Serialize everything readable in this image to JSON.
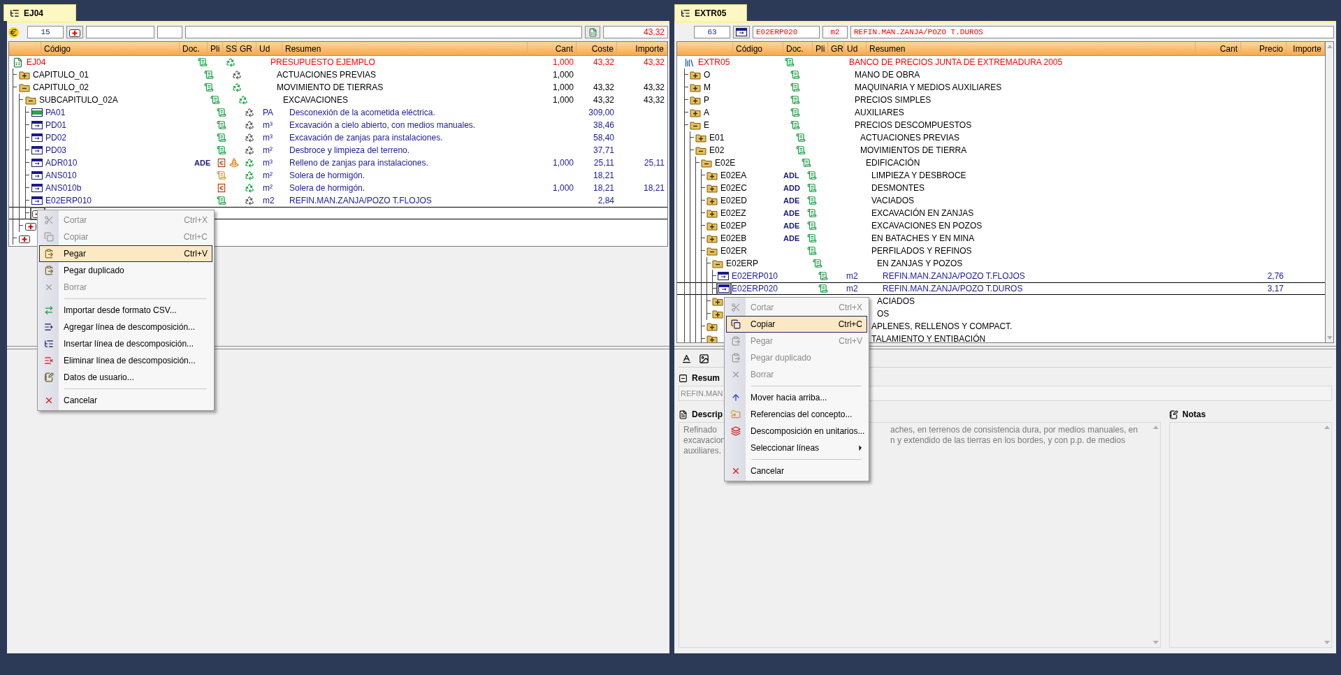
{
  "left_panel": {
    "tab": "EJ04",
    "toolbar": {
      "count": "15",
      "total": "43,32"
    },
    "columns": [
      "Código",
      "Doc.",
      "Pli",
      "SS",
      "GR",
      "Ud",
      "Resumen",
      "Cant",
      "Coste",
      "Importe"
    ],
    "rows": [
      {
        "kind": "root",
        "code": "EJ04",
        "pli": {
          "kind": "green"
        },
        "gr": {
          "kind": "green"
        },
        "summary": "PRESUPUESTO EJEMPLO",
        "cant": "1,000",
        "price": "43,32",
        "amount": "43,32",
        "selected": false,
        "children": [
          {
            "kind": "chapter",
            "code": "CAPITULO_01",
            "pli": {
              "kind": "green"
            },
            "gr": {
              "kind": "gray"
            },
            "summary": "ACTUACIONES PREVIAS",
            "cant": "1,000",
            "selected": false,
            "expanded": false
          },
          {
            "kind": "chapter",
            "code": "CAPITULO_02",
            "pli": {
              "kind": "green"
            },
            "gr": {
              "kind": "green"
            },
            "summary": "MOVIMIENTO DE TIERRAS",
            "cant": "1,000",
            "price": "43,32",
            "amount": "43,32",
            "selected": false,
            "expanded": true,
            "children": [
              {
                "kind": "chapter",
                "code": "SUBCAPITULO_02A",
                "pli": {
                  "kind": "green"
                },
                "gr": {
                  "kind": "green"
                },
                "summary": "EXCAVACIONES",
                "cant": "1,000",
                "price": "43,32",
                "amount": "43,32",
                "selected": false,
                "expanded": true,
                "children": [
                  {
                    "kind": "lump",
                    "code": "PA01",
                    "pli": {
                      "kind": "green"
                    },
                    "gr": {
                      "kind": "gray"
                    },
                    "unit": "PA",
                    "summary": "Desconexión de la acometida eléctrica.",
                    "price": "309,00",
                    "selected": false
                  },
                  {
                    "kind": "item",
                    "code": "PD01",
                    "pli": {
                      "kind": "green"
                    },
                    "gr": {
                      "kind": "gray"
                    },
                    "unit": "m³",
                    "summary": "Excavación a cielo abierto, con medios manuales.",
                    "price": "38,46",
                    "selected": false
                  },
                  {
                    "kind": "item",
                    "code": "PD02",
                    "pli": {
                      "kind": "green"
                    },
                    "gr": {
                      "kind": "gray"
                    },
                    "unit": "m³",
                    "summary": "Excavación de zanjas para instalaciones.",
                    "price": "58,40",
                    "selected": false
                  },
                  {
                    "kind": "item",
                    "code": "PD03",
                    "pli": {
                      "kind": "green"
                    },
                    "gr": {
                      "kind": "gray"
                    },
                    "unit": "m²",
                    "summary": "Desbroce y limpieza del terreno.",
                    "price": "37,71",
                    "selected": false
                  },
                  {
                    "kind": "item",
                    "code": "ADR010",
                    "doc": "ADE",
                    "pli": {
                      "kind": "euro"
                    },
                    "ss": {
                      "kind": "cone"
                    },
                    "gr": {
                      "kind": "green"
                    },
                    "unit": "m³",
                    "summary": "Relleno de zanjas para instalaciones.",
                    "cant": "1,000",
                    "price": "25,11",
                    "amount": "25,11",
                    "selected": false
                  },
                  {
                    "kind": "item",
                    "code": "ANS010",
                    "pli": {
                      "kind": "yellow"
                    },
                    "gr": {
                      "kind": "green"
                    },
                    "unit": "m²",
                    "summary": "Solera de hormigón.",
                    "price": "18,21",
                    "selected": false
                  },
                  {
                    "kind": "item",
                    "code": "ANS010b",
                    "pli": {
                      "kind": "euro"
                    },
                    "gr": {
                      "kind": "green"
                    },
                    "unit": "m²",
                    "summary": "Solera de hormigón.",
                    "cant": "1,000",
                    "price": "18,21",
                    "amount": "18,21",
                    "selected": false
                  },
                  {
                    "kind": "item",
                    "code": "E02ERP010",
                    "pli": {
                      "kind": "green"
                    },
                    "gr": {
                      "kind": "gray"
                    },
                    "unit": "m2",
                    "summary": "REFIN.MAN.ZANJA/POZO T.FLOJOS",
                    "price": "2,84",
                    "selected": false
                  },
                  {
                    "kind": "new",
                    "selected": true
                  }
                ]
              },
              {
                "kind": "new",
                "selected": false
              }
            ]
          },
          {
            "kind": "new",
            "selected": false
          }
        ]
      }
    ],
    "context_menu": [
      {
        "kind": "item",
        "label": "Cortar",
        "shortcut": "Ctrl+X",
        "disabled": true,
        "selected": false,
        "submenu": false
      },
      {
        "kind": "item",
        "label": "Copiar",
        "shortcut": "Ctrl+C",
        "disabled": true,
        "selected": false,
        "submenu": false
      },
      {
        "kind": "item",
        "label": "Pegar",
        "shortcut": "Ctrl+V",
        "disabled": false,
        "selected": true,
        "submenu": false
      },
      {
        "kind": "item",
        "label": "Pegar duplicado",
        "disabled": false,
        "selected": false,
        "submenu": false
      },
      {
        "kind": "item",
        "label": "Borrar",
        "disabled": true,
        "selected": false,
        "submenu": false
      },
      {
        "kind": "separator"
      },
      {
        "kind": "item",
        "label": "Importar desde formato CSV...",
        "disabled": false,
        "selected": false,
        "submenu": false
      },
      {
        "kind": "item",
        "label": "Agregar línea de descomposición...",
        "disabled": false,
        "selected": false,
        "submenu": false
      },
      {
        "kind": "item",
        "label": "Insertar línea de descomposición...",
        "disabled": false,
        "selected": false,
        "submenu": false
      },
      {
        "kind": "item",
        "label": "Eliminar línea de descomposición...",
        "disabled": false,
        "selected": false,
        "submenu": false
      },
      {
        "kind": "item",
        "label": "Datos de usuario...",
        "disabled": false,
        "selected": false,
        "submenu": false
      },
      {
        "kind": "separator"
      },
      {
        "kind": "item",
        "label": "Cancelar",
        "disabled": false,
        "selected": false,
        "submenu": false
      }
    ]
  },
  "right_panel": {
    "tab": "EXTR05",
    "toolbar": {
      "count": "63",
      "code": "E02ERP020",
      "unit": "m2",
      "summary": "REFIN.MAN.ZANJA/POZO T.DUROS"
    },
    "columns": [
      "Código",
      "Doc.",
      "Pli",
      "GR",
      "Ud",
      "Resumen",
      "Cant",
      "Precio",
      "Importe"
    ],
    "rows": [
      {
        "kind": "root",
        "code": "EXTR05",
        "pli": {
          "kind": "green"
        },
        "summary": "BANCO DE PRECIOS JUNTA DE EXTREMADURA 2005",
        "selected": false,
        "children": [
          {
            "kind": "chapter",
            "code": "O",
            "pli": {
              "kind": "green"
            },
            "summary": "MANO DE OBRA",
            "selected": false,
            "expanded": false
          },
          {
            "kind": "chapter",
            "code": "M",
            "pli": {
              "kind": "green"
            },
            "summary": "MAQUINARIA Y MEDIOS AUXILIARES",
            "selected": false,
            "expanded": false
          },
          {
            "kind": "chapter",
            "code": "P",
            "pli": {
              "kind": "green"
            },
            "summary": "PRECIOS SIMPLES",
            "selected": false,
            "expanded": false
          },
          {
            "kind": "chapter",
            "code": "A",
            "pli": {
              "kind": "green"
            },
            "summary": "AUXILIARES",
            "selected": false,
            "expanded": false
          },
          {
            "kind": "chapter",
            "code": "E",
            "pli": {
              "kind": "green"
            },
            "summary": "PRECIOS DESCOMPUESTOS",
            "selected": false,
            "expanded": true,
            "children": [
              {
                "kind": "chapter",
                "code": "E01",
                "pli": {
                  "kind": "green"
                },
                "summary": "ACTUACIONES PREVIAS",
                "selected": false,
                "expanded": false
              },
              {
                "kind": "chapter",
                "code": "E02",
                "pli": {
                  "kind": "green"
                },
                "summary": "MOVIMIENTOS DE TIERRA",
                "selected": false,
                "expanded": true,
                "children": [
                  {
                    "kind": "chapter",
                    "code": "E02E",
                    "pli": {
                      "kind": "green"
                    },
                    "summary": "EDIFICACIÓN",
                    "selected": false,
                    "expanded": true,
                    "children": [
                      {
                        "kind": "chapter",
                        "code": "E02EA",
                        "doc": "ADL",
                        "pli": {
                          "kind": "green"
                        },
                        "summary": "LIMPIEZA Y DESBROCE",
                        "selected": false,
                        "expanded": false
                      },
                      {
                        "kind": "chapter",
                        "code": "E02EC",
                        "doc": "ADD",
                        "pli": {
                          "kind": "green"
                        },
                        "summary": "DESMONTES",
                        "selected": false,
                        "expanded": false
                      },
                      {
                        "kind": "chapter",
                        "code": "E02ED",
                        "doc": "ADE",
                        "pli": {
                          "kind": "green"
                        },
                        "summary": "VACIADOS",
                        "selected": false,
                        "expanded": false
                      },
                      {
                        "kind": "chapter",
                        "code": "E02EZ",
                        "doc": "ADE",
                        "pli": {
                          "kind": "green"
                        },
                        "summary": "EXCAVACIÓN EN ZANJAS",
                        "selected": false,
                        "expanded": false
                      },
                      {
                        "kind": "chapter",
                        "code": "E02EP",
                        "doc": "ADE",
                        "pli": {
                          "kind": "green"
                        },
                        "summary": "EXCAVACIONES EN POZOS",
                        "selected": false,
                        "expanded": false
                      },
                      {
                        "kind": "chapter",
                        "code": "E02EB",
                        "doc": "ADE",
                        "pli": {
                          "kind": "green"
                        },
                        "summary": "EN BATACHES Y EN MINA",
                        "selected": false,
                        "expanded": false
                      },
                      {
                        "kind": "chapter",
                        "code": "E02ER",
                        "pli": {
                          "kind": "green"
                        },
                        "summary": "PERFILADOS Y REFINOS",
                        "selected": false,
                        "expanded": true,
                        "children": [
                          {
                            "kind": "chapter",
                            "code": "E02ERP",
                            "pli": {
                              "kind": "green"
                            },
                            "summary": "EN ZANJAS Y POZOS",
                            "selected": false,
                            "expanded": true,
                            "children": [
                              {
                                "kind": "item",
                                "code": "E02ERP010",
                                "pli": {
                                  "kind": "green"
                                },
                                "unit": "m2",
                                "summary": "REFIN.MAN.ZANJA/POZO T.FLOJOS",
                                "price": "2,76",
                                "selected": false
                              },
                              {
                                "kind": "item",
                                "code": "E02ERP020",
                                "pli": {
                                  "kind": "green"
                                },
                                "unit": "m2",
                                "summary": "REFIN.MAN.ZANJA/POZO T.DUROS",
                                "price": "3,17",
                                "selected": true
                              }
                            ]
                          },
                          {
                            "kind": "chapter",
                            "summary": "ACIADOS",
                            "selected": false,
                            "expanded": false
                          },
                          {
                            "kind": "chapter",
                            "summary": "OS",
                            "selected": false,
                            "expanded": false
                          }
                        ]
                      },
                      {
                        "kind": "chapter",
                        "summary": "APLENES, RELLENOS Y COMPACT.",
                        "selected": false,
                        "expanded": false
                      },
                      {
                        "kind": "chapter",
                        "summary": "TALAMIENTO Y ENTIBACIÓN",
                        "selected": false,
                        "expanded": false
                      }
                    ]
                  }
                ]
              }
            ]
          }
        ]
      }
    ],
    "context_menu": [
      {
        "kind": "item",
        "label": "Cortar",
        "shortcut": "Ctrl+X",
        "disabled": true,
        "selected": false,
        "submenu": false
      },
      {
        "kind": "item",
        "label": "Copiar",
        "shortcut": "Ctrl+C",
        "disabled": false,
        "selected": true,
        "submenu": false
      },
      {
        "kind": "item",
        "label": "Pegar",
        "shortcut": "Ctrl+V",
        "disabled": true,
        "selected": false,
        "submenu": false
      },
      {
        "kind": "item",
        "label": "Pegar duplicado",
        "disabled": true,
        "selected": false,
        "submenu": false
      },
      {
        "kind": "item",
        "label": "Borrar",
        "disabled": true,
        "selected": false,
        "submenu": false
      },
      {
        "kind": "separator"
      },
      {
        "kind": "item",
        "label": "Mover hacia arriba...",
        "disabled": false,
        "selected": false,
        "submenu": false
      },
      {
        "kind": "item",
        "label": "Referencias del concepto...",
        "disabled": false,
        "selected": false,
        "submenu": false
      },
      {
        "kind": "item",
        "label": "Descomposición en unitarios...",
        "disabled": false,
        "selected": false,
        "submenu": false
      },
      {
        "kind": "item",
        "label": "Seleccionar líneas",
        "disabled": false,
        "selected": false,
        "submenu": true
      },
      {
        "kind": "separator"
      },
      {
        "kind": "item",
        "label": "Cancelar",
        "disabled": false,
        "selected": false,
        "submenu": false
      }
    ],
    "detail": {
      "summary_label": "Resum",
      "summary_value": "REFIN.MAN",
      "description_label": "Descrip",
      "description_lines": [
        {
          "left": "Refinado",
          "right": "aches, en terrenos de consistencia dura, por medios manuales, en"
        },
        {
          "left": "excavacion",
          "right": "n y extendido de las tierras en los bordes, y con p.p. de medios"
        },
        {
          "left": "auxiliares."
        }
      ],
      "notes_label": "Notas"
    }
  }
}
